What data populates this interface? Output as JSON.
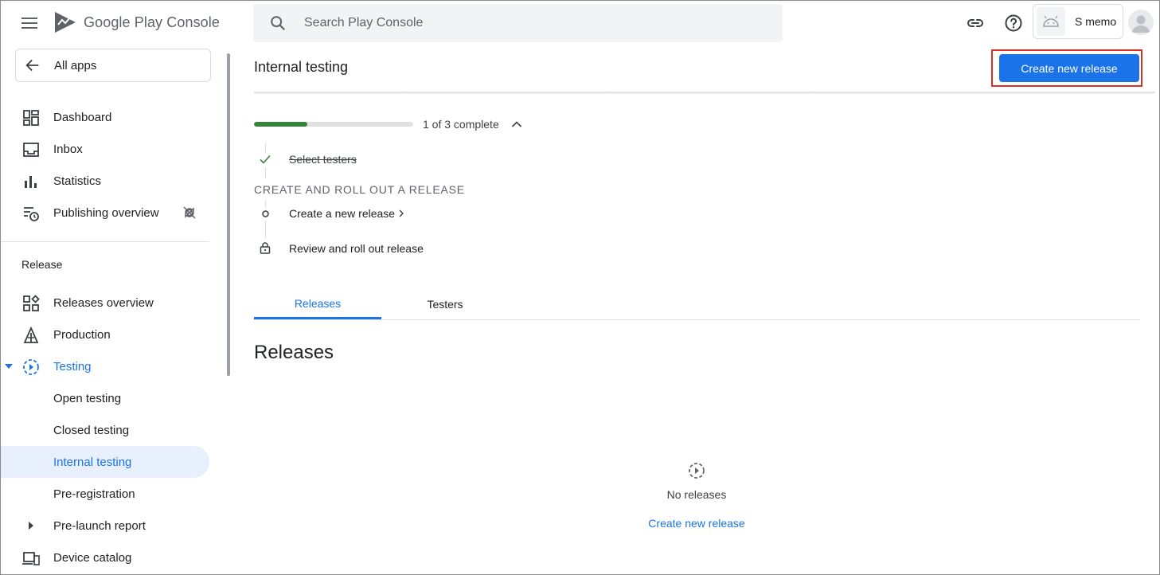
{
  "header": {
    "logo_text": "Google Play Console",
    "search_placeholder": "Search Play Console",
    "app_name": "S memo"
  },
  "sidebar": {
    "all_apps": "All apps",
    "top_items": [
      {
        "label": "Dashboard",
        "icon": "dashboard-icon"
      },
      {
        "label": "Inbox",
        "icon": "inbox-icon"
      },
      {
        "label": "Statistics",
        "icon": "bar-chart-icon"
      },
      {
        "label": "Publishing overview",
        "icon": "publishing-icon",
        "badge_icon": "sync-disabled-icon"
      }
    ],
    "release_heading": "Release",
    "release_items": [
      {
        "label": "Releases overview",
        "icon": "releases-overview-icon"
      },
      {
        "label": "Production",
        "icon": "production-icon"
      },
      {
        "label": "Testing",
        "icon": "testing-icon",
        "expanded": true
      },
      {
        "label": "Open testing"
      },
      {
        "label": "Closed testing"
      },
      {
        "label": "Internal testing",
        "active": true
      },
      {
        "label": "Pre-registration"
      },
      {
        "label": "Pre-launch report",
        "icon": "caret-right-icon"
      },
      {
        "label": "Device catalog",
        "icon": "devices-icon"
      }
    ]
  },
  "main": {
    "title": "Internal testing",
    "primary_button": "Create new release",
    "progress": {
      "completed": 1,
      "total": 3,
      "text": "1 of 3 complete"
    },
    "steps": {
      "select_testers": "Select testers",
      "stage_heading": "CREATE AND ROLL OUT A RELEASE",
      "create_release": "Create a new release",
      "review_rollout": "Review and roll out release"
    },
    "tabs": [
      {
        "label": "Releases",
        "active": true
      },
      {
        "label": "Testers",
        "active": false
      }
    ],
    "section_title": "Releases",
    "empty_state": {
      "text": "No releases",
      "link": "Create new release"
    }
  },
  "colors": {
    "accent": "#1a73e8",
    "progress": "#34843c",
    "highlight": "#d93025"
  }
}
